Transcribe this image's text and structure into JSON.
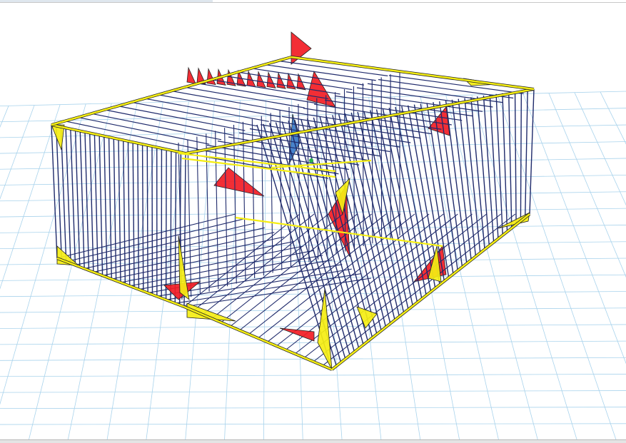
{
  "viewport": {
    "view": "3d-structural-diagram",
    "colors": {
      "background": "#ffffff",
      "grid": "#a9d3ec",
      "frame": "#1f2a6b",
      "frame_highlight": "#3a7ac8",
      "diagram_positive": "#f21c24",
      "diagram_negative": "#f5ee12",
      "diagram_outline": "#222222",
      "node_marker": "#27b14a"
    }
  }
}
